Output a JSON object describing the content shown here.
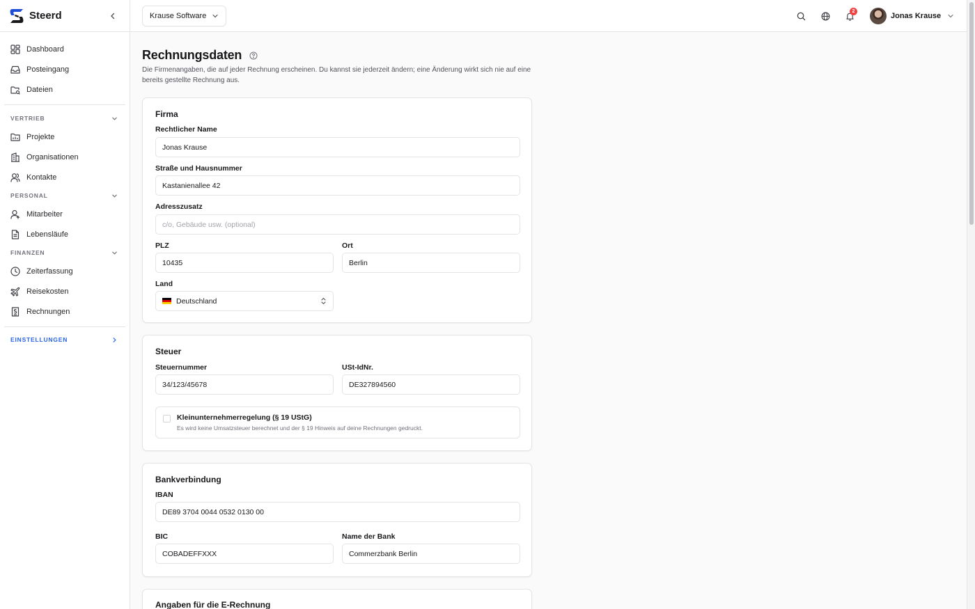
{
  "app": {
    "brand_name": "Steerd"
  },
  "sidebar": {
    "top_items": [
      {
        "label": "Dashboard",
        "icon": "dashboard-icon"
      },
      {
        "label": "Posteingang",
        "icon": "inbox-icon"
      },
      {
        "label": "Dateien",
        "icon": "folder-icon"
      }
    ],
    "groups": [
      {
        "label": "VERTRIEB",
        "items": [
          {
            "label": "Projekte",
            "icon": "projects-icon"
          },
          {
            "label": "Organisationen",
            "icon": "building-icon"
          },
          {
            "label": "Kontakte",
            "icon": "contacts-icon"
          }
        ]
      },
      {
        "label": "PERSONAL",
        "items": [
          {
            "label": "Mitarbeiter",
            "icon": "user-icon"
          },
          {
            "label": "Lebensläufe",
            "icon": "document-icon"
          }
        ]
      },
      {
        "label": "FINANZEN",
        "items": [
          {
            "label": "Zeiterfassung",
            "icon": "clock-icon"
          },
          {
            "label": "Reisekosten",
            "icon": "plane-icon"
          },
          {
            "label": "Rechnungen",
            "icon": "invoice-icon"
          }
        ]
      }
    ],
    "settings_label": "EINSTELLUNGEN"
  },
  "topbar": {
    "org_name": "Krause Software",
    "notification_count": "2",
    "user_name": "Jonas Krause"
  },
  "page": {
    "title": "Rechnungsdaten",
    "description": "Die Firmenangaben, die auf jeder Rechnung erscheinen. Du kannst sie jederzeit ändern; eine Änderung wirkt sich nie auf eine bereits gestellte Rechnung aus."
  },
  "firma": {
    "title": "Firma",
    "legal_name_label": "Rechtlicher Name",
    "legal_name_value": "Jonas Krause",
    "street_label": "Straße und Hausnummer",
    "street_value": "Kastanienallee 42",
    "address_extra_label": "Adresszusatz",
    "address_extra_placeholder": "c/o, Gebäude usw. (optional)",
    "zip_label": "PLZ",
    "zip_value": "10435",
    "city_label": "Ort",
    "city_value": "Berlin",
    "country_label": "Land",
    "country_value": "Deutschland"
  },
  "steuer": {
    "title": "Steuer",
    "tax_number_label": "Steuernummer",
    "tax_number_value": "34/123/45678",
    "vat_id_label": "USt-IdNr.",
    "vat_id_value": "DE327894560",
    "small_business_label": "Kleinunternehmerregelung (§ 19 UStG)",
    "small_business_desc": "Es wird keine Umsatzsteuer berechnet und der § 19 Hinweis auf deine Rechnungen gedruckt.",
    "small_business_checked": false
  },
  "bank": {
    "title": "Bankverbindung",
    "iban_label": "IBAN",
    "iban_value": "DE89 3704 0044 0532 0130 00",
    "bic_label": "BIC",
    "bic_value": "COBADEFFXXX",
    "bank_name_label": "Name der Bank",
    "bank_name_value": "Commerzbank Berlin"
  },
  "erechnung": {
    "title": "Angaben für die E-Rechnung"
  },
  "colors": {
    "accent": "#2563eb",
    "badge": "#ef4444"
  }
}
